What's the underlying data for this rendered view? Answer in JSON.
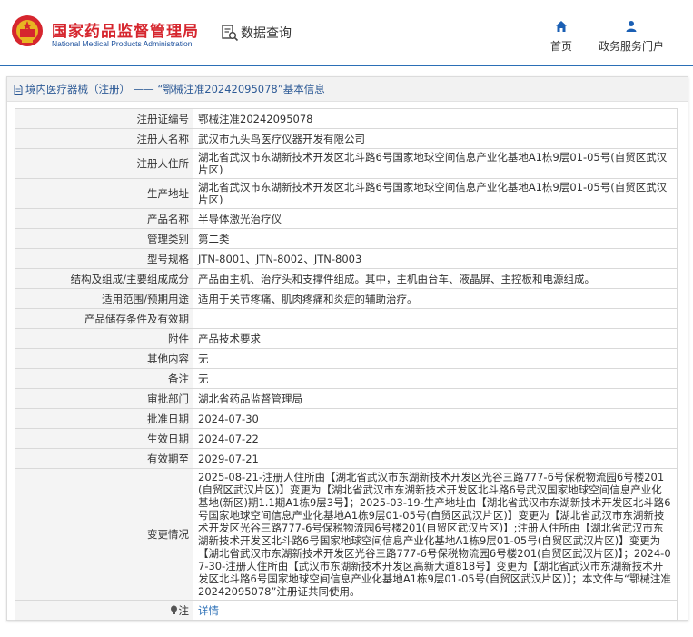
{
  "header": {
    "logo_cn": "国家药品监督管理局",
    "logo_en": "National Medical Products Administration",
    "query_label": "数据查询",
    "nav": [
      {
        "label": "首页",
        "icon": "home-icon"
      },
      {
        "label": "政务服务门户",
        "icon": "user-icon"
      }
    ],
    "colors": {
      "brand_red": "#d6262e",
      "brand_blue": "#1a4f9c",
      "link_blue": "#2b6fb6"
    }
  },
  "breadcrumb": {
    "section": "境内医疗器械（注册）",
    "separator": "——",
    "current": "“鄂械注准20242095078”基本信息"
  },
  "rows": [
    {
      "key": "注册证编号",
      "value": "鄂械注准20242095078"
    },
    {
      "key": "注册人名称",
      "value": "武汉市九头鸟医疗仪器开发有限公司"
    },
    {
      "key": "注册人住所",
      "value": "湖北省武汉市东湖新技术开发区北斗路6号国家地球空间信息产业化基地A1栋9层01-05号(自贸区武汉片区)"
    },
    {
      "key": "生产地址",
      "value": "湖北省武汉市东湖新技术开发区北斗路6号国家地球空间信息产业化基地A1栋9层01-05号(自贸区武汉片区)"
    },
    {
      "key": "产品名称",
      "value": "半导体激光治疗仪"
    },
    {
      "key": "管理类别",
      "value": "第二类"
    },
    {
      "key": "型号规格",
      "value": "JTN-8001、JTN-8002、JTN-8003"
    },
    {
      "key": "结构及组成/主要组成成分",
      "value": "产品由主机、治疗头和支撑件组成。其中，主机由台车、液晶屏、主控板和电源组成。"
    },
    {
      "key": "适用范围/预期用途",
      "value": "适用于关节疼痛、肌肉疼痛和炎症的辅助治疗。"
    },
    {
      "key": "产品储存条件及有效期",
      "value": ""
    },
    {
      "key": "附件",
      "value": "产品技术要求"
    },
    {
      "key": "其他内容",
      "value": "无"
    },
    {
      "key": "备注",
      "value": "无"
    },
    {
      "key": "审批部门",
      "value": "湖北省药品监督管理局"
    },
    {
      "key": "批准日期",
      "value": "2024-07-30"
    },
    {
      "key": "生效日期",
      "value": "2024-07-22"
    },
    {
      "key": "有效期至",
      "value": "2029-07-21"
    },
    {
      "key": "变更情况",
      "value": "2025-08-21-注册人住所由【湖北省武汉市东湖新技术开发区光谷三路777-6号保税物流园6号楼201(自贸区武汉片区)】变更为【湖北省武汉市东湖新技术开发区北斗路6号武汉国家地球空间信息产业化基地(新区)期1.1期A1栋9层3号】；2025-03-19-生产地址由【湖北省武汉市东湖新技术开发区北斗路6号国家地球空间信息产业化基地A1栋9层01-05号(自贸区武汉片区)】变更为【湖北省武汉市东湖新技术开发区光谷三路777-6号保税物流园6号楼201(自贸区武汉片区)】;注册人住所由【湖北省武汉市东湖新技术开发区北斗路6号国家地球空间信息产业化基地A1栋9层01-05号(自贸区武汉片区)】变更为【湖北省武汉市东湖新技术开发区光谷三路777-6号保税物流园6号楼201(自贸区武汉片区)】；2024-07-30-注册人住所由【武汉市东湖新技术开发区高新大道818号】变更为【湖北省武汉市东湖新技术开发区北斗路6号国家地球空间信息产业化基地A1栋9层01-05号(自贸区武汉片区)】；本文件与“鄂械注准20242095078”注册证共同使用。"
    }
  ],
  "note": {
    "key": "注",
    "icon": "lightbulb-icon",
    "link": "详情"
  }
}
